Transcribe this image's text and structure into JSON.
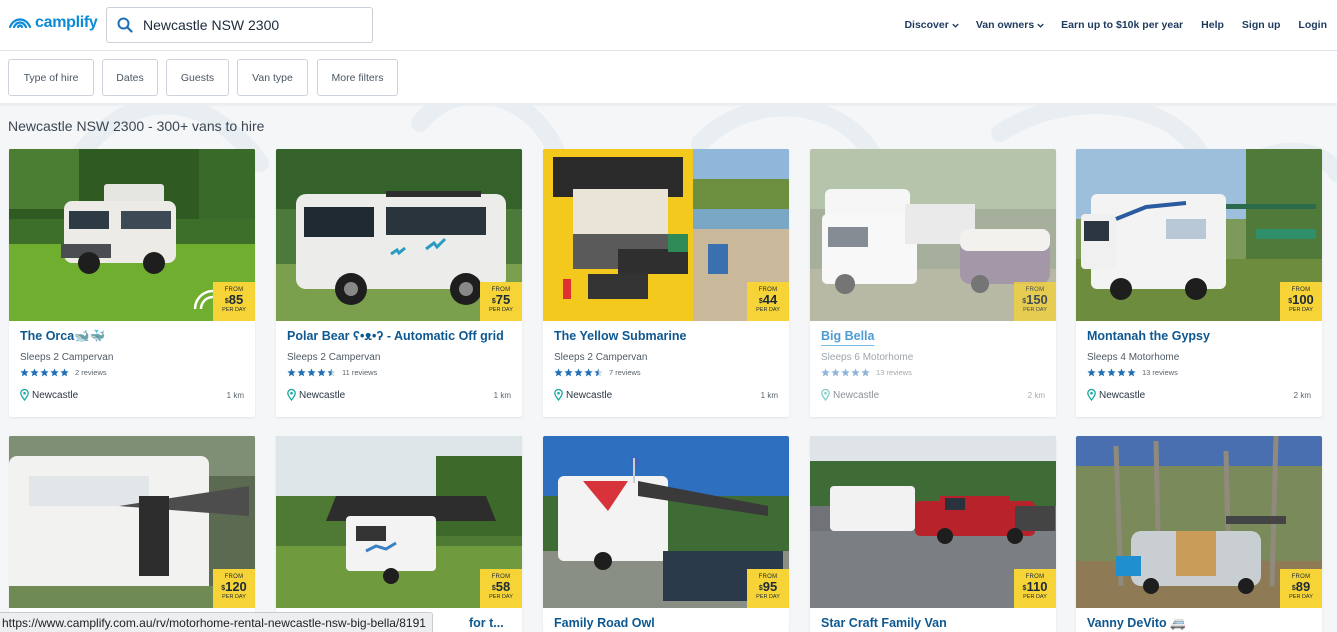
{
  "brand": {
    "name": "camplify",
    "color": "#0b8bd6"
  },
  "search": {
    "value": "Newcastle NSW 2300"
  },
  "nav": {
    "discover": "Discover",
    "van_owners": "Van owners",
    "earn": "Earn up to $10k per year",
    "help": "Help",
    "signup": "Sign up",
    "login": "Login"
  },
  "filters": [
    "Type of hire",
    "Dates",
    "Guests",
    "Van type",
    "More filters"
  ],
  "results_title": "Newcastle NSW 2300 - 300+ vans to hire",
  "price_from": "FROM",
  "price_per": "PER DAY",
  "price_currency": "$",
  "listings": [
    {
      "name": "The Orca🐋🐳",
      "sleeps": "Sleeps 2 Campervan",
      "rating": 5,
      "reviews": "2 reviews",
      "location": "Newcastle",
      "distance": "1 km",
      "price": "85"
    },
    {
      "name": "Polar Bear ʕ•ᴥ•ʔ - Automatic Off grid",
      "sleeps": "Sleeps 2 Campervan",
      "rating": 4.5,
      "reviews": "11 reviews",
      "location": "Newcastle",
      "distance": "1 km",
      "price": "75"
    },
    {
      "name": "The Yellow Submarine",
      "sleeps": "Sleeps 2 Campervan",
      "rating": 4.5,
      "reviews": "7 reviews",
      "location": "Newcastle",
      "distance": "1 km",
      "price": "44"
    },
    {
      "name": "Big Bella",
      "sleeps": "Sleeps 6 Motorhome",
      "rating": 5,
      "reviews": "13 reviews",
      "location": "Newcastle",
      "distance": "2 km",
      "price": "150"
    },
    {
      "name": "Montanah the Gypsy",
      "sleeps": "Sleeps 4 Motorhome",
      "rating": 5,
      "reviews": "13 reviews",
      "location": "Newcastle",
      "distance": "2 km",
      "price": "100"
    },
    {
      "name": "",
      "price": "120"
    },
    {
      "name": "for t...",
      "price": "58"
    },
    {
      "name": "Family Road Owl",
      "price": "95"
    },
    {
      "name": "Star Craft Family Van",
      "price": "110"
    },
    {
      "name": "Vanny DeVito 🚐",
      "price": "89"
    }
  ],
  "status_url": "https://www.camplify.com.au/rv/motorhome-rental-newcastle-nsw-big-bella/8191",
  "colors": {
    "price_badge": "#f6d336",
    "title_blue": "#0e5891",
    "star_blue": "#1f6fb6"
  }
}
